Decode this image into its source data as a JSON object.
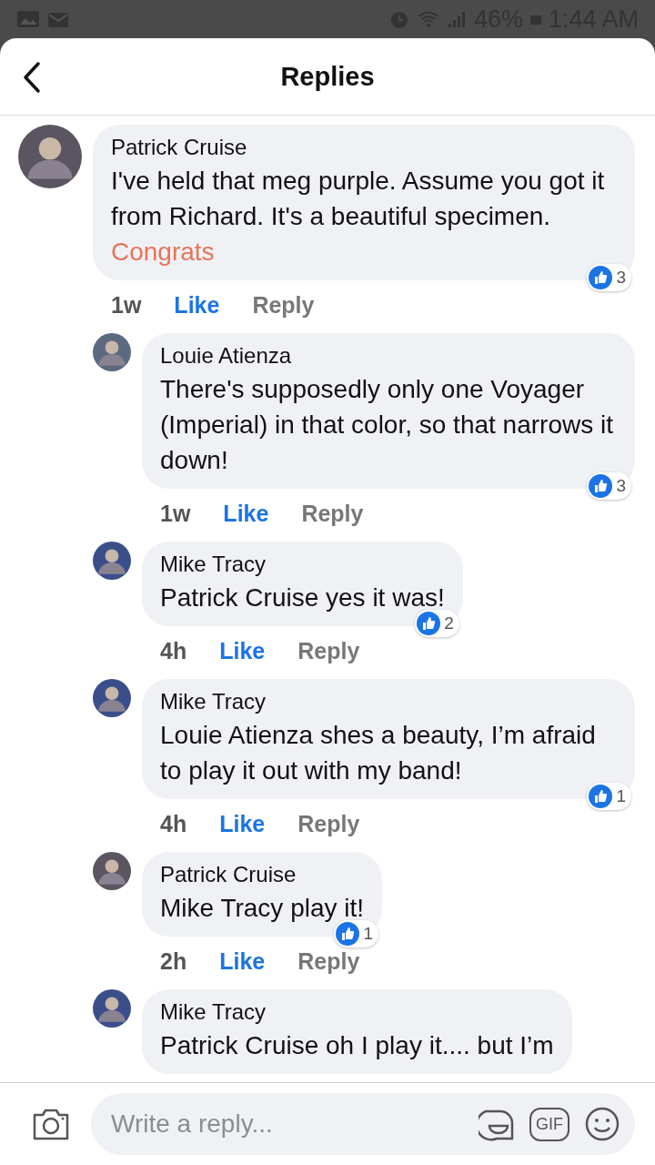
{
  "status_bar": {
    "battery": "46%",
    "time": "1:44 AM"
  },
  "header": {
    "title": "Replies"
  },
  "comments": [
    {
      "color": "#5a5560",
      "name": "Patrick Cruise",
      "text": "I've held that meg purple. Assume you got it from Richard. It's a beautiful specimen.",
      "mention": "Congrats",
      "time": "1w",
      "like": "Like",
      "reply": "Reply",
      "reactions": "3",
      "replies": [
        {
          "color": "#5b6a80",
          "name": "Louie Atienza",
          "text": "There's supposedly only one Voyager (Imperial) in that color, so that narrows it down!",
          "time": "1w",
          "like": "Like",
          "reply": "Reply",
          "reactions": "3"
        },
        {
          "color": "#3a4f8a",
          "name": "Mike Tracy",
          "text": "Patrick Cruise yes it was!",
          "time": "4h",
          "like": "Like",
          "reply": "Reply",
          "reactions": "2"
        },
        {
          "color": "#3a4f8a",
          "name": "Mike Tracy",
          "text": "Louie Atienza shes a beauty, I’m afraid to play it out with my band!",
          "time": "4h",
          "like": "Like",
          "reply": "Reply",
          "reactions": "1"
        },
        {
          "color": "#5a5560",
          "name": "Patrick Cruise",
          "text": "Mike Tracy play it!",
          "time": "2h",
          "like": "Like",
          "reply": "Reply",
          "reactions": "1"
        },
        {
          "color": "#3a4f8a",
          "name": "Mike Tracy",
          "text": "Patrick Cruise oh I play it.... but I’m"
        }
      ]
    }
  ],
  "composer": {
    "placeholder": "Write a reply...",
    "gif": "GIF"
  }
}
